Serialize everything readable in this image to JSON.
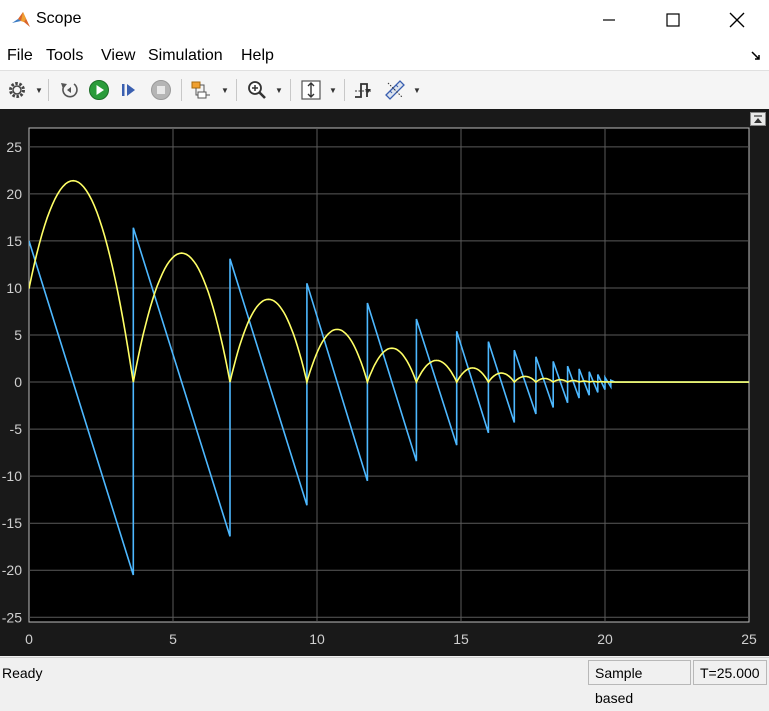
{
  "window": {
    "title": "Scope",
    "icon": "matlab-logo-icon",
    "controls": [
      "minimize-icon",
      "maximize-icon",
      "close-icon"
    ]
  },
  "menu": {
    "items": [
      "File",
      "Tools",
      "View",
      "Simulation",
      "Help"
    ]
  },
  "toolbar": {
    "buttons": [
      {
        "name": "settings",
        "icon": "gear-icon"
      },
      {
        "name": "step-back",
        "icon": "step-back-icon"
      },
      {
        "name": "run",
        "icon": "play-icon"
      },
      {
        "name": "step-forward",
        "icon": "step-forward-icon"
      },
      {
        "name": "stop",
        "icon": "stop-icon"
      },
      {
        "name": "highlight-block",
        "icon": "block-diagram-icon"
      },
      {
        "name": "zoom",
        "icon": "zoom-in-icon"
      },
      {
        "name": "autoscale",
        "icon": "scale-axes-icon"
      },
      {
        "name": "triggers",
        "icon": "trigger-icon"
      },
      {
        "name": "measurements",
        "icon": "ruler-icon"
      }
    ]
  },
  "colors": {
    "plot_background": "#000000",
    "frame_background": "#191919",
    "grid": "#5a5a5a",
    "axis_text": "#cfcfcf",
    "series_position": "#ffff66",
    "series_velocity": "#4db8ff"
  },
  "chart_data": {
    "type": "line",
    "title": "",
    "xlabel": "",
    "ylabel": "",
    "xlim": [
      0,
      25
    ],
    "ylim": [
      -25.5,
      27
    ],
    "xticks": [
      0,
      5,
      10,
      15,
      20,
      25
    ],
    "yticks": [
      25,
      20,
      15,
      10,
      5,
      0,
      -5,
      -10,
      -15,
      -20,
      -25
    ],
    "grid": true,
    "legend": "none",
    "series": [
      {
        "color": "#ffff66",
        "bounces": [
          {
            "t0": 0,
            "t1": 3.62,
            "y0": 10,
            "peak_t": 1.53,
            "peak": 21.4
          },
          {
            "t0": 3.62,
            "t1": 6.98,
            "peak": 13.7
          },
          {
            "t0": 6.98,
            "t1": 9.65,
            "peak": 8.8
          },
          {
            "t0": 9.65,
            "t1": 11.75,
            "peak": 5.6
          },
          {
            "t0": 11.75,
            "t1": 13.45,
            "peak": 3.6
          },
          {
            "t0": 13.45,
            "t1": 14.85,
            "peak": 2.3
          },
          {
            "t0": 14.85,
            "t1": 15.95,
            "peak": 1.5
          },
          {
            "t0": 15.95,
            "t1": 16.85,
            "peak": 0.95
          },
          {
            "t0": 16.85,
            "t1": 17.6,
            "peak": 0.6
          },
          {
            "t0": 17.6,
            "t1": 18.2,
            "peak": 0.38
          },
          {
            "t0": 18.2,
            "t1": 18.7,
            "peak": 0.25
          },
          {
            "t0": 18.7,
            "t1": 19.1,
            "peak": 0.16
          },
          {
            "t0": 19.1,
            "t1": 19.45,
            "peak": 0.1
          },
          {
            "t0": 19.45,
            "t1": 19.75,
            "peak": 0.06
          },
          {
            "t0": 19.75,
            "t1": 20.0,
            "peak": 0.04
          },
          {
            "t0": 20.0,
            "t1": 20.2,
            "peak": 0.02
          }
        ],
        "rest_until": 25
      },
      {
        "color": "#4db8ff",
        "points": [
          [
            0,
            15
          ],
          [
            3.62,
            -20.5
          ],
          [
            3.62,
            16.4
          ],
          [
            6.98,
            -16.4
          ],
          [
            6.98,
            13.1
          ],
          [
            9.65,
            -13.1
          ],
          [
            9.65,
            10.5
          ],
          [
            11.75,
            -10.5
          ],
          [
            11.75,
            8.4
          ],
          [
            13.45,
            -8.4
          ],
          [
            13.45,
            6.7
          ],
          [
            14.85,
            -6.7
          ],
          [
            14.85,
            5.4
          ],
          [
            15.95,
            -5.4
          ],
          [
            15.95,
            4.3
          ],
          [
            16.85,
            -4.3
          ],
          [
            16.85,
            3.4
          ],
          [
            17.6,
            -3.4
          ],
          [
            17.6,
            2.7
          ],
          [
            18.2,
            -2.7
          ],
          [
            18.2,
            2.2
          ],
          [
            18.7,
            -2.2
          ],
          [
            18.7,
            1.7
          ],
          [
            19.1,
            -1.7
          ],
          [
            19.1,
            1.4
          ],
          [
            19.45,
            -1.4
          ],
          [
            19.45,
            1.1
          ],
          [
            19.75,
            -1.1
          ],
          [
            19.75,
            0.8
          ],
          [
            20.0,
            -0.8
          ],
          [
            20.0,
            0.5
          ],
          [
            20.2,
            -0.5
          ],
          [
            20.2,
            0.2
          ],
          [
            20.35,
            0
          ],
          [
            25,
            0
          ]
        ]
      }
    ]
  },
  "status": {
    "left": "Ready",
    "mode": "Sample based",
    "time": "T=25.000"
  }
}
